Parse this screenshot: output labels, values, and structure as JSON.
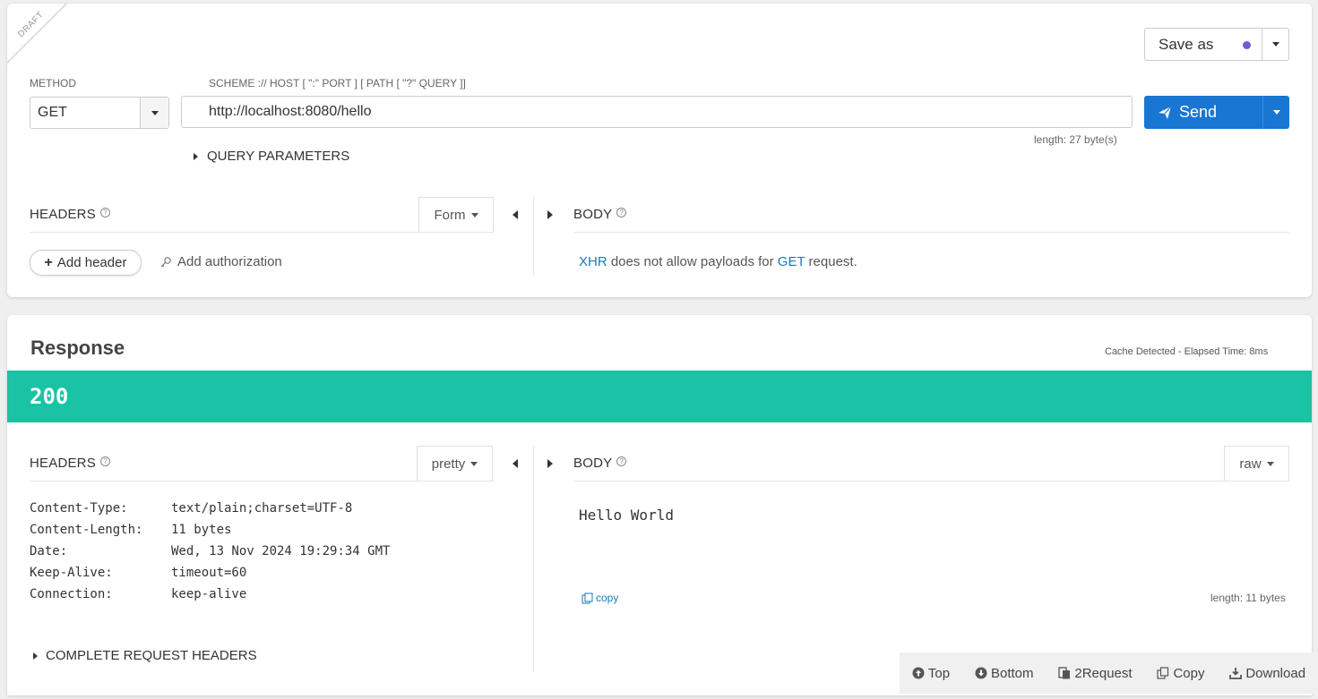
{
  "request": {
    "draft_label": "DRAFT",
    "method_label": "METHOD",
    "method_value": "GET",
    "url_label": "SCHEME :// HOST [ \":\" PORT ] [ PATH [ \"?\" QUERY ]]",
    "url_value": "http://localhost:8080/hello",
    "length_text": "length: 27 byte(s)",
    "save_label": "Save as",
    "send_label": "Send",
    "query_params_label": "QUERY PARAMETERS",
    "headers_title": "HEADERS",
    "headers_mode": "Form",
    "add_header_label": "Add header",
    "add_auth_label": "Add authorization",
    "body_title": "BODY",
    "body_msg_xhr": "XHR",
    "body_msg_mid": " does not allow payloads for ",
    "body_msg_get": "GET",
    "body_msg_end": " request."
  },
  "response": {
    "title": "Response",
    "cache_text": "Cache Detected - Elapsed Time: 8ms",
    "status_code": "200",
    "status_color": "#19c3a4",
    "headers_title": "HEADERS",
    "headers_mode": "pretty",
    "headers": [
      {
        "key": "Content-Type:",
        "value": "text/plain;charset=UTF-8"
      },
      {
        "key": "Content-Length:",
        "value": "11 bytes"
      },
      {
        "key": "Date:",
        "value": "Wed, 13 Nov 2024 19:29:34 GMT"
      },
      {
        "key": "Keep-Alive:",
        "value": "timeout=60"
      },
      {
        "key": "Connection:",
        "value": "keep-alive"
      }
    ],
    "complete_headers_label": "COMPLETE REQUEST HEADERS",
    "body_title": "BODY",
    "body_mode": "raw",
    "body_content": "Hello World",
    "copy_label": "copy",
    "length_text": "length: 11 bytes"
  },
  "footer": {
    "top_label": "Top",
    "bottom_label": "Bottom",
    "to_request_label": "2Request",
    "copy_label": "Copy",
    "download_label": "Download"
  },
  "colors": {
    "send_blue": "#1976d2",
    "link_blue": "#1a7ab8",
    "save_dot": "#6a5fcd"
  }
}
